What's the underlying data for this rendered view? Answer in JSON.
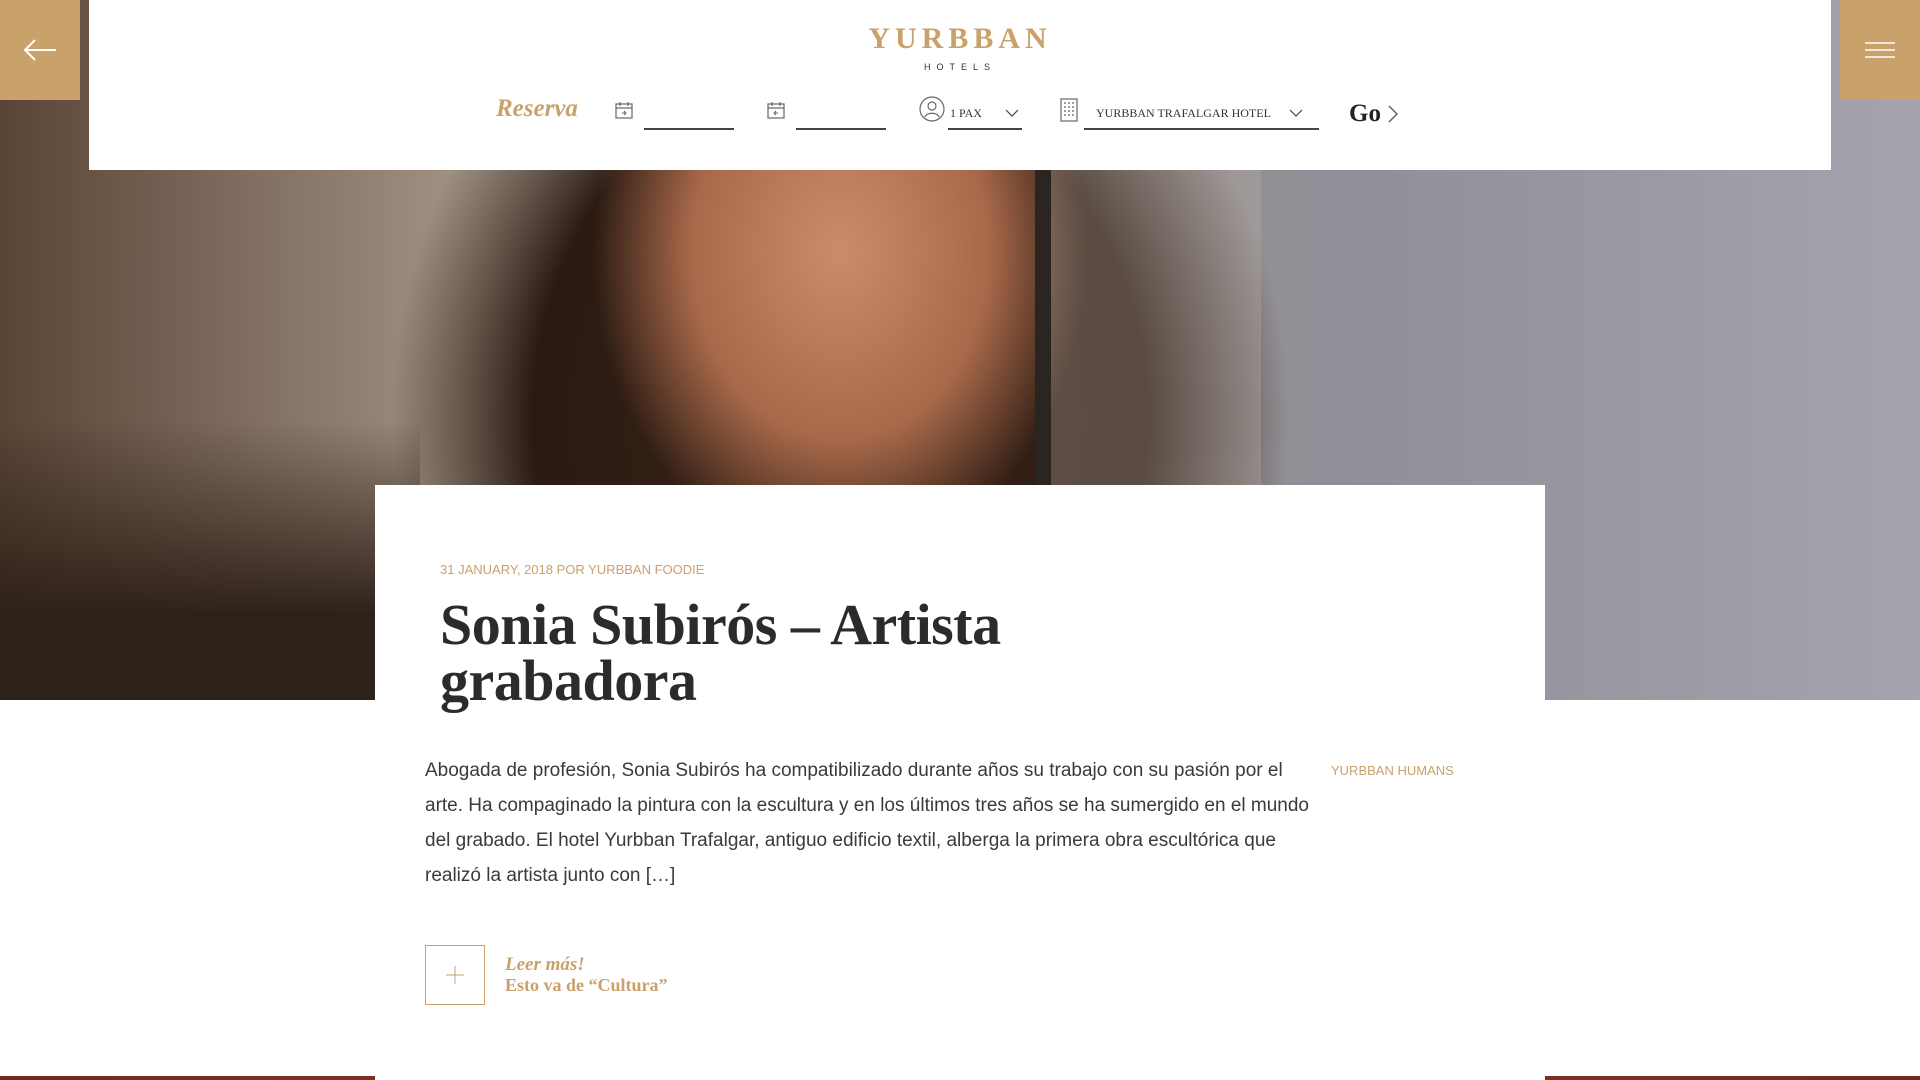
{
  "header": {
    "brand": "YURBBAN",
    "brand_sub": "HOTELS"
  },
  "booking": {
    "label": "Reserva",
    "checkin_value": "",
    "checkout_value": "",
    "guests": "1 PAX",
    "hotel": "YURBBAN TRAFALGAR HOTEL",
    "go_label": "Go"
  },
  "nav": {
    "back_icon": "arrow-left-icon",
    "menu_icon": "hamburger-menu-icon"
  },
  "article": {
    "meta": "31 January, 2018 por Yurbban Foodie",
    "title": "Sonia Subirós – Artista grabadora",
    "excerpt": "Abogada de profesión, Sonia Subirós ha compatibilizado durante años su trabajo con su pasión por el arte. Ha compaginado la pintura con la escultura y en los últimos tres años se ha sumergido en el mundo del grabado.  El hotel Yurbban Trafalgar, antiguo edificio textil, alberga la primera obra escultórica que realizó la artista junto con […]",
    "tag": "Yurbban Humans",
    "read_more": "Leer más!",
    "category_line": "Esto va de “Cultura”"
  },
  "colors": {
    "accent": "#c9a16b",
    "text": "#2b2b2b"
  }
}
